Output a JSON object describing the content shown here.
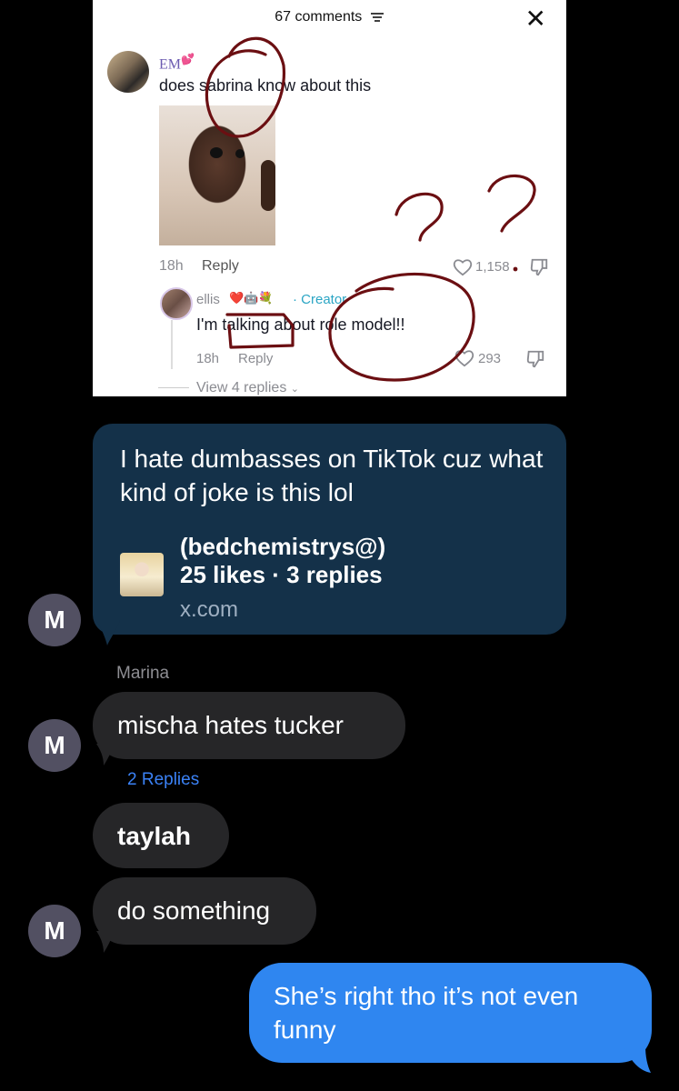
{
  "tiktok": {
    "comment_count": "67 comments",
    "comment1": {
      "author": "EM",
      "author_emoji": "💕",
      "text": "does sabrina know about this",
      "time": "18h",
      "reply_label": "Reply",
      "likes": "1,158"
    },
    "comment2": {
      "author": "ellis",
      "badges": "❤️🤖💐",
      "creator_label": "· Creator",
      "text": "I'm talking about role model!!",
      "time": "18h",
      "reply_label": "Reply",
      "likes": "293"
    },
    "view_replies": "View 4 replies",
    "scribbles": [
      "??"
    ]
  },
  "share_card": {
    "message": "I hate dumbasses on TikTok cuz what kind of joke is this lol",
    "author": "(bedchemistrys@)",
    "stats": "25 likes · 3 replies",
    "domain": "x.com"
  },
  "messages": {
    "sender_initial": "M",
    "sender_name": "Marina",
    "msg1": "mischa hates tucker",
    "replies_link": "2 Replies",
    "msg2": "taylah",
    "msg3": "do something",
    "my_msg": "She’s right tho it’s not even funny"
  },
  "colors": {
    "share_bubble": "#143149",
    "incoming_bubble": "#262628",
    "outgoing_bubble": "#2f86f0",
    "annotation_ink": "#6b0f12"
  }
}
